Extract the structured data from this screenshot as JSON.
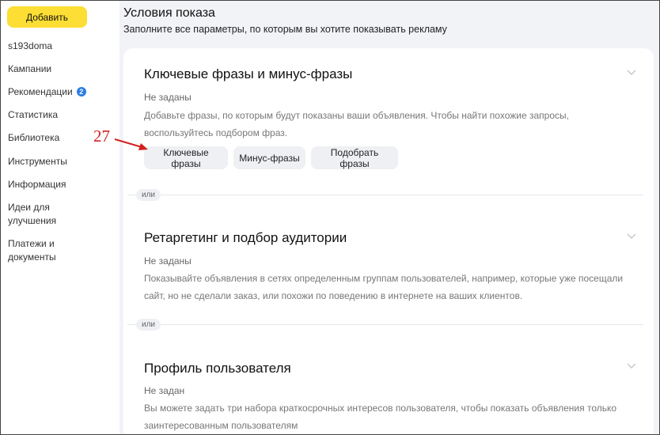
{
  "sidebar": {
    "add_button": "Добавить",
    "items": [
      {
        "label": "s193doma"
      },
      {
        "label": "Кампании"
      },
      {
        "label": "Рекомендации",
        "badge": "2"
      },
      {
        "label": "Статистика"
      },
      {
        "label": "Библиотека"
      },
      {
        "label": "Инструменты"
      },
      {
        "label": "Информация"
      },
      {
        "label": "Идеи для улучшения"
      },
      {
        "label": "Платежи и документы"
      }
    ]
  },
  "main": {
    "title": "Условия показа",
    "subtitle": "Заполните все параметры, по которым вы хотите показывать рекламу",
    "separator_label": "или",
    "sections": [
      {
        "title": "Ключевые фразы и минус-фразы",
        "status": "Не заданы",
        "description": "Добавьте фразы, по которым будут показаны ваши объявления. Чтобы найти похожие запросы, воспользуйтесь подбором фраз.",
        "buttons": [
          "Ключевые фразы",
          "Минус-фразы",
          "Подобрать фразы"
        ]
      },
      {
        "title": "Ретаргетинг и подбор аудитории",
        "status": "Не заданы",
        "description": "Показывайте объявления в сетях определенным группам пользователей, например, которые уже посещали сайт, но не сделали заказ, или похожи по поведению в интернете на ваших клиентов."
      },
      {
        "title": "Профиль пользователя",
        "status": "Не задан",
        "description": "Вы можете задать три набора краткосрочных интересов пользователя, чтобы показать объявления только заинтересованным пользователям"
      }
    ]
  },
  "annotation": {
    "number": "27",
    "color": "#d42020"
  },
  "colors": {
    "accent_yellow": "#fdde35",
    "badge_blue": "#2c7be5"
  },
  "icons": {
    "section_toggle": "chevron-down-icon",
    "annotation_pointer": "arrow-icon"
  }
}
